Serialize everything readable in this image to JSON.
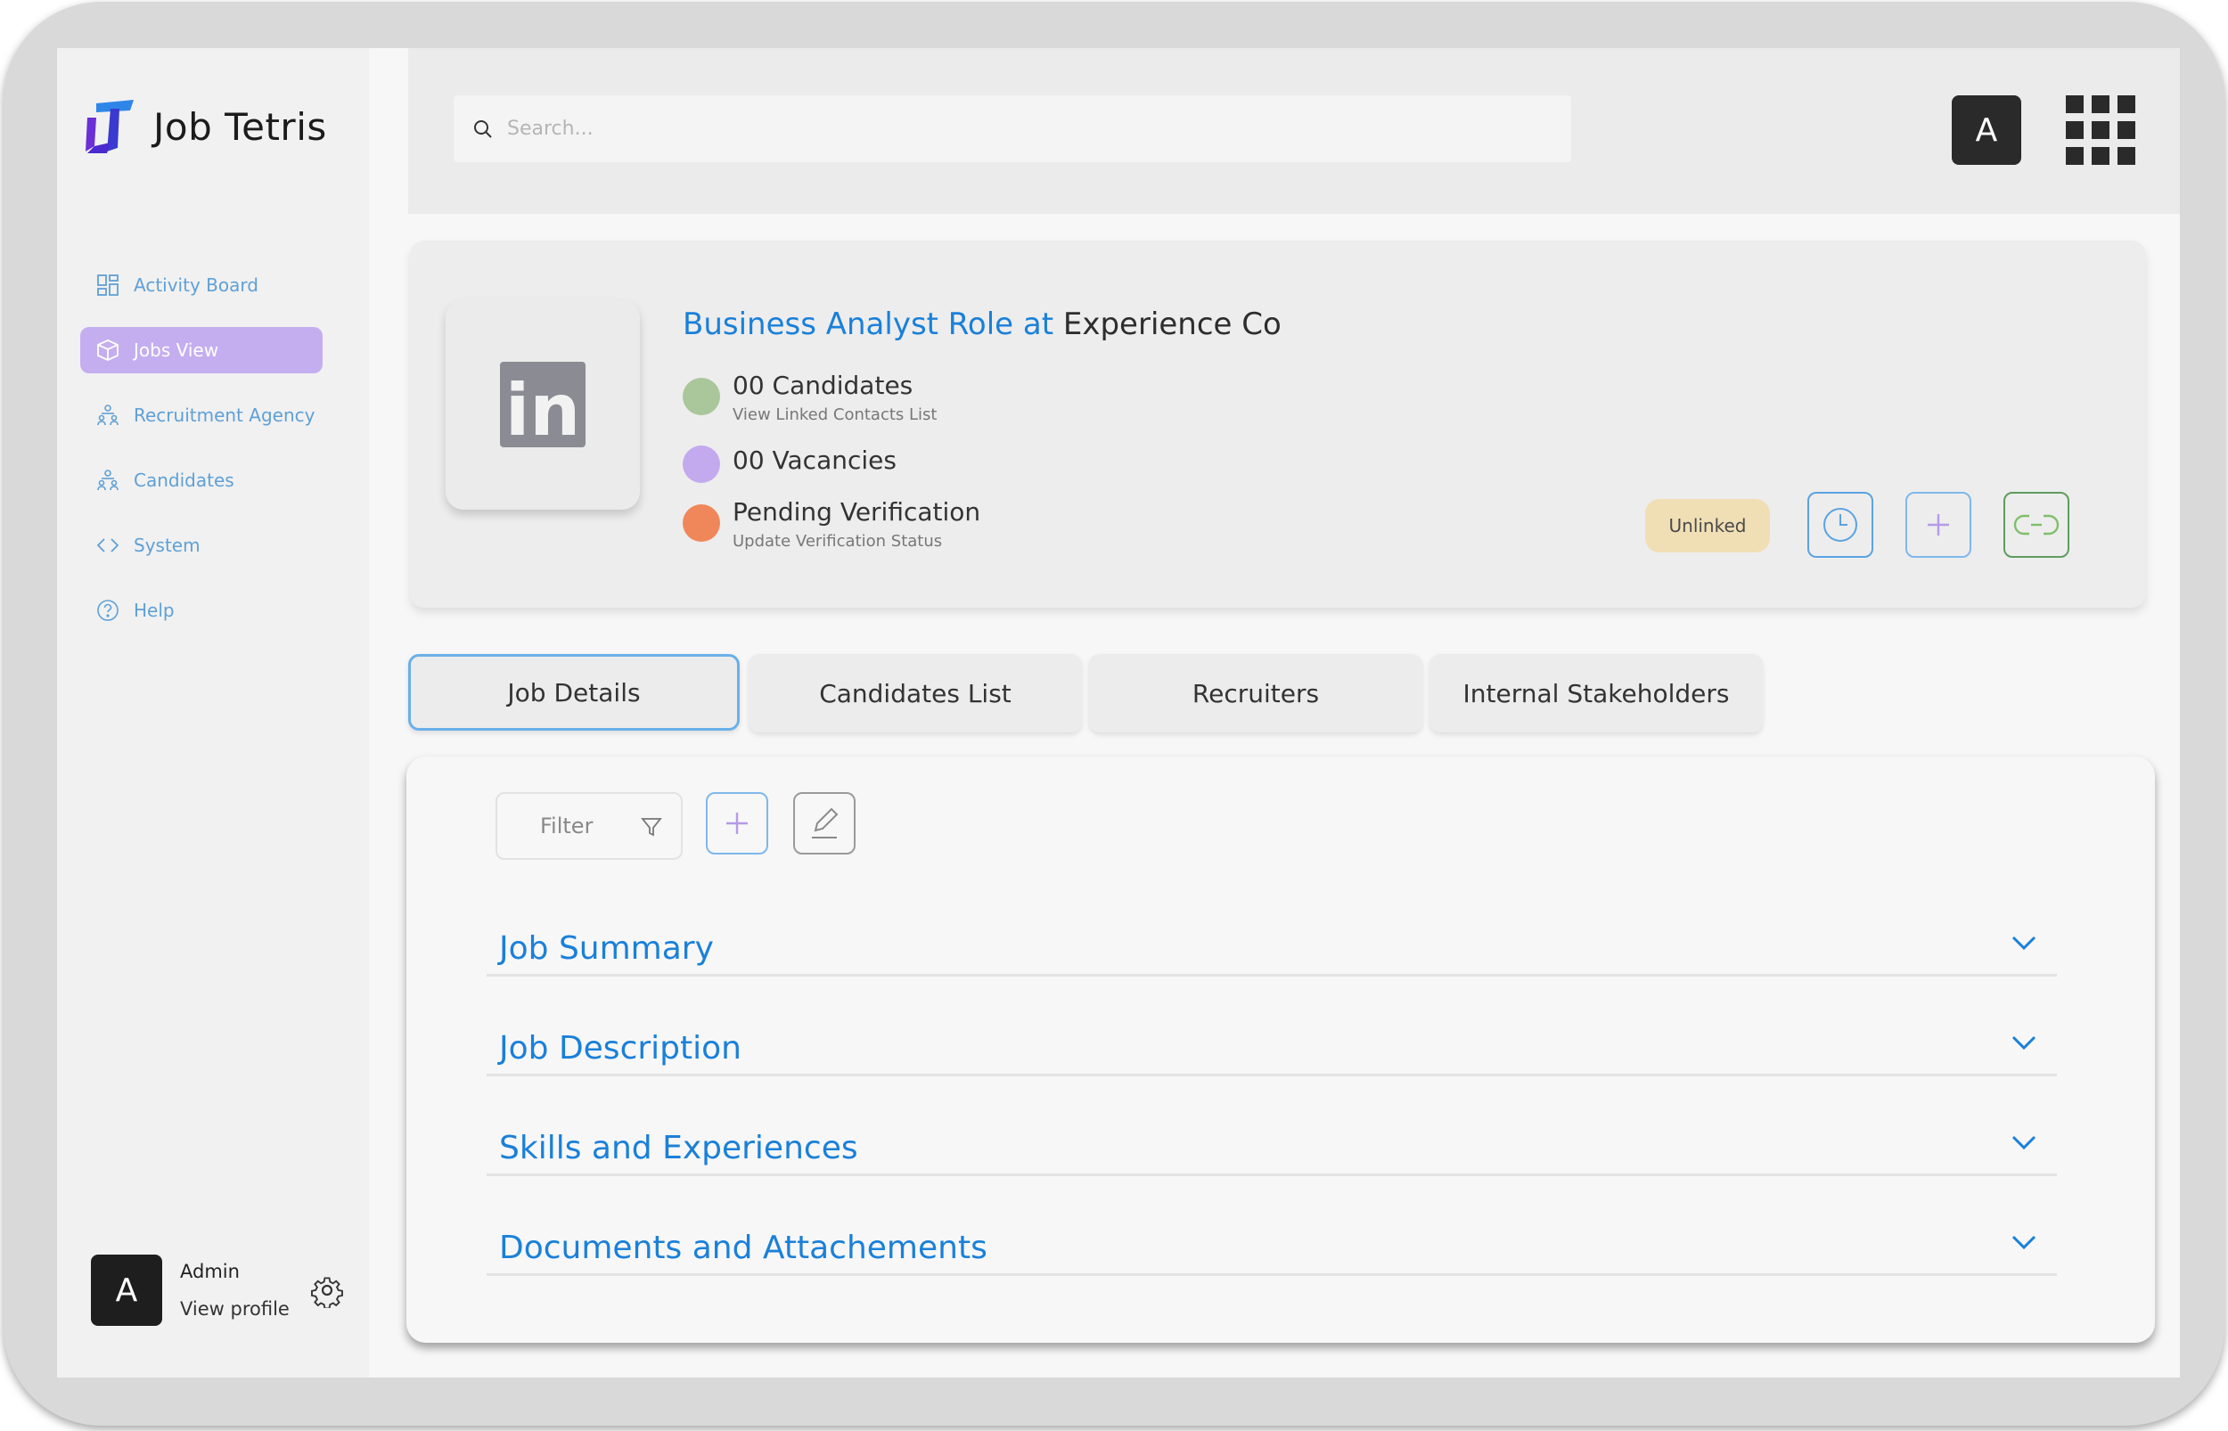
{
  "app": {
    "name": "Job Tetris"
  },
  "sidebar": {
    "items": [
      {
        "label": "Activity Board",
        "icon": "grid-layout-icon",
        "active": false
      },
      {
        "label": "Jobs View",
        "icon": "cube-icon",
        "active": true
      },
      {
        "label": "Recruitment Agency",
        "icon": "users-hierarchy-icon",
        "active": false
      },
      {
        "label": "Candidates",
        "icon": "users-hierarchy-icon",
        "active": false
      },
      {
        "label": "System",
        "icon": "code-icon",
        "active": false
      },
      {
        "label": "Help",
        "icon": "help-circle-icon",
        "active": false
      }
    ],
    "user": {
      "initial": "A",
      "name": "Admin",
      "link": "View profile"
    }
  },
  "header": {
    "search_placeholder": "Search...",
    "avatar_initial": "A"
  },
  "job": {
    "title_prefix": "Business Analyst Role at",
    "company": "Experience Co",
    "logo_text": "in",
    "stats": [
      {
        "main": "00 Candidates",
        "sub": "View Linked Contacts List",
        "color": "#a9c79a"
      },
      {
        "main": "00 Vacancies",
        "sub": "",
        "color": "#c3a9ee"
      },
      {
        "main": "Pending Verification",
        "sub": "Update Verification Status",
        "color": "#f0875a"
      }
    ],
    "status_badge": "Unlinked"
  },
  "tabs": [
    {
      "label": "Job Details",
      "active": true
    },
    {
      "label": "Candidates List",
      "active": false
    },
    {
      "label": "Recruiters",
      "active": false
    },
    {
      "label": "Internal Stakeholders",
      "active": false
    }
  ],
  "toolbar": {
    "filter_label": "Filter"
  },
  "sections": [
    {
      "title": "Job Summary"
    },
    {
      "title": "Job Description"
    },
    {
      "title": "Skills and Experiences"
    },
    {
      "title": "Documents and Attachements"
    }
  ],
  "colors": {
    "accent_blue": "#1a80d9",
    "active_nav": "#c4aef0",
    "badge_bg": "#f0dfb5"
  }
}
